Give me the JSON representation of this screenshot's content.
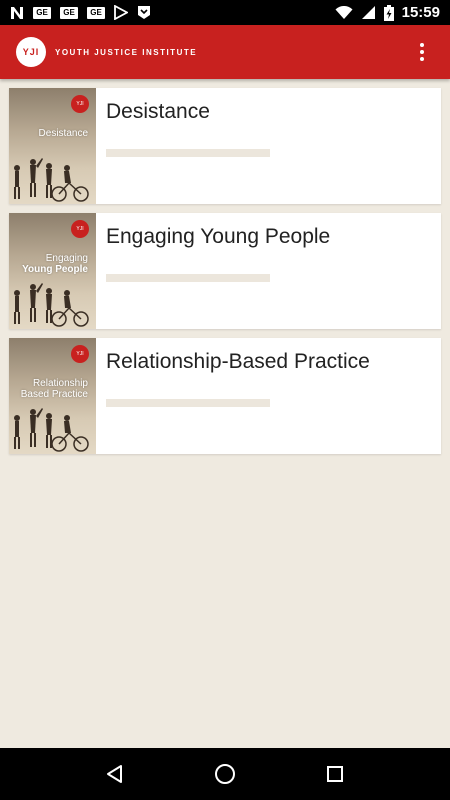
{
  "status_bar": {
    "time": "15:59",
    "left_icons": [
      "n-icon",
      "ge-icon",
      "ge-icon",
      "ge-icon",
      "play-store-icon",
      "download-icon"
    ],
    "ge_label": "GE",
    "right_icons": [
      "wifi-icon",
      "signal-icon",
      "battery-charging-icon"
    ]
  },
  "app_bar": {
    "logo_text": "YJI",
    "brand": "YOUTH JUSTICE INSTITUTE",
    "menu_icon": "more-vert-icon",
    "accent_color": "#c8211f"
  },
  "modules": [
    {
      "title": "Desistance",
      "thumb_line1": "",
      "thumb_line2": "Desistance",
      "progress": 0
    },
    {
      "title": "Engaging Young People",
      "thumb_line1": "Engaging",
      "thumb_line2": "Young People",
      "progress": 0
    },
    {
      "title": "Relationship-Based Practice",
      "thumb_line1": "Relationship",
      "thumb_line2": "Based Practice",
      "progress": 0
    }
  ],
  "thumb_badge": "YJI",
  "nav_bar": {
    "back_icon": "back-triangle-icon",
    "home_icon": "home-circle-icon",
    "recents_icon": "recents-square-icon"
  }
}
